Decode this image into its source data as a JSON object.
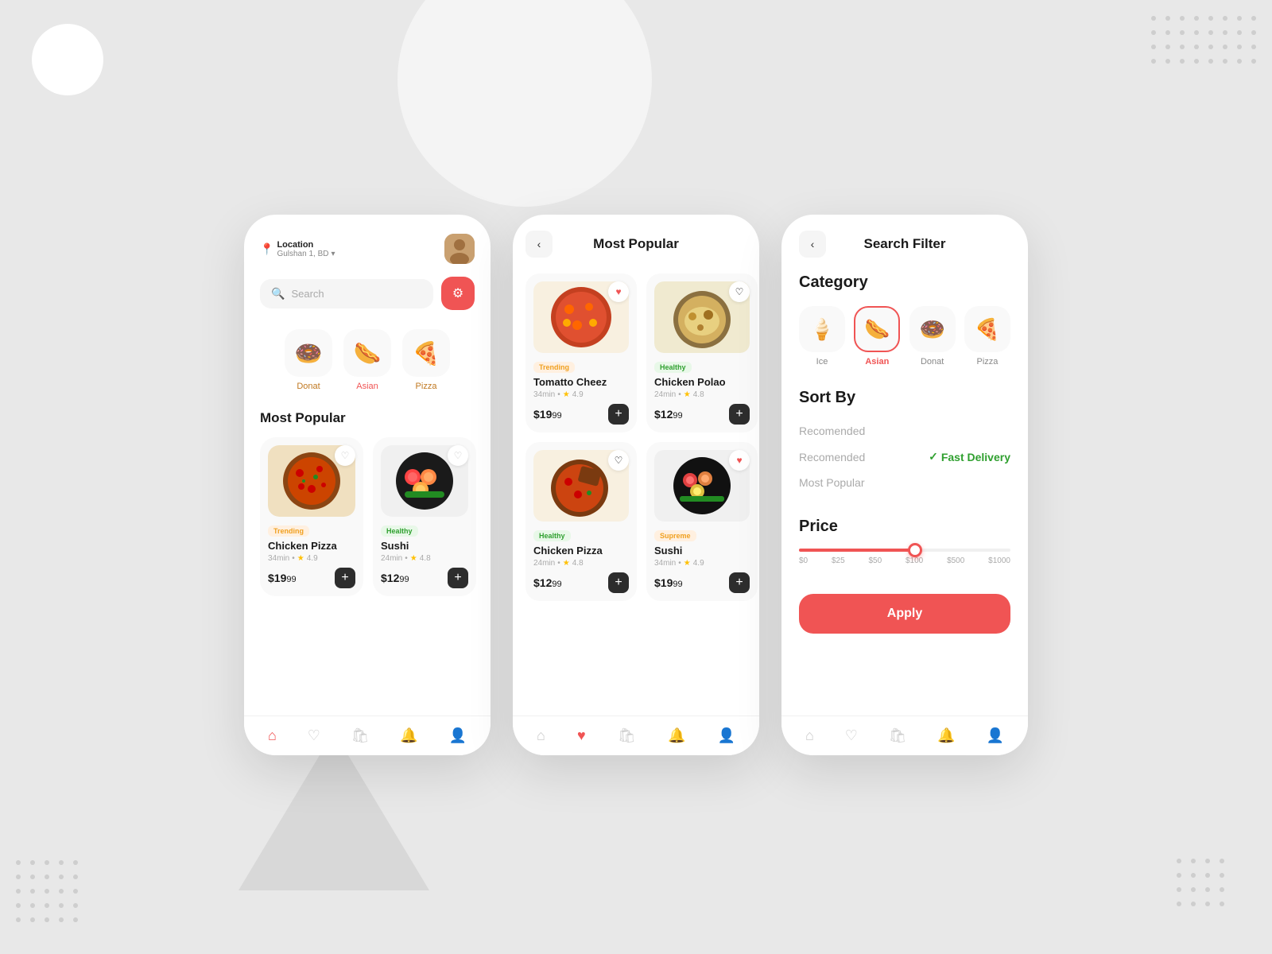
{
  "background": {
    "color": "#e2e2e2"
  },
  "screen1": {
    "location_label": "Location",
    "location_city": "Gulshan 1, BD",
    "search_placeholder": "Search",
    "categories": [
      {
        "id": "donat",
        "label": "Donat",
        "emoji": "🍩",
        "color": "#c07820"
      },
      {
        "id": "asian",
        "label": "Asian",
        "emoji": "🌭",
        "color": "#f05454"
      },
      {
        "id": "pizza",
        "label": "Pizza",
        "emoji": "🍕",
        "color": "#c07820"
      }
    ],
    "section_title": "Most Popular",
    "cards": [
      {
        "name": "Chicken Pizza",
        "badge": "Trending",
        "badge_type": "trending",
        "time": "34min",
        "rating": "4.9",
        "price": "$19",
        "cents": "99"
      },
      {
        "name": "Sushi",
        "badge": "Healthy",
        "badge_type": "healthy",
        "time": "24min",
        "rating": "4.8",
        "price": "$12",
        "cents": "99"
      }
    ],
    "nav_items": [
      "home",
      "heart",
      "bag",
      "bell",
      "person"
    ]
  },
  "screen2": {
    "title": "Most Popular",
    "back_label": "‹",
    "cards": [
      {
        "name": "Tomatto Cheez",
        "badge": "Trending",
        "badge_type": "trending",
        "time": "34min",
        "rating": "4.9",
        "price": "$19",
        "cents": "99",
        "liked": true
      },
      {
        "name": "Chicken Polao",
        "badge": "Healthy",
        "badge_type": "healthy",
        "time": "24min",
        "rating": "4.8",
        "price": "$12",
        "cents": "99",
        "liked": false
      },
      {
        "name": "Chicken Pizza",
        "badge": "Healthy",
        "badge_type": "healthy",
        "time": "24min",
        "rating": "4.8",
        "price": "$12",
        "cents": "99",
        "liked": false
      },
      {
        "name": "Sushi",
        "badge": "Supreme",
        "badge_type": "supreme",
        "time": "34min",
        "rating": "4.9",
        "price": "$19",
        "cents": "99",
        "liked": true
      }
    ],
    "nav_items": [
      "home",
      "heart",
      "bag",
      "bell",
      "person"
    ]
  },
  "screen3": {
    "title": "Search Filter",
    "back_label": "‹",
    "category_section": "Category",
    "categories": [
      {
        "id": "ice",
        "label": "Ice",
        "emoji": "🍦",
        "selected": false
      },
      {
        "id": "asian",
        "label": "Asian",
        "emoji": "🌭",
        "selected": true
      },
      {
        "id": "donat",
        "label": "Donat",
        "emoji": "🍩",
        "selected": false
      },
      {
        "id": "pizza",
        "label": "Pizza",
        "emoji": "🍕",
        "selected": false
      }
    ],
    "sort_section": "Sort By",
    "sort_options": [
      {
        "label": "Recomended",
        "value": "",
        "selected": false
      },
      {
        "label": "Fast Delivery",
        "value": "Fast Delivery",
        "selected": true
      },
      {
        "label": "Most Popular",
        "value": "",
        "selected": false
      }
    ],
    "price_section": "Price",
    "price_labels": [
      "$0",
      "$25",
      "$50",
      "$100",
      "$500",
      "$1000"
    ],
    "price_value": 100,
    "price_fill_percent": 55,
    "apply_label": "Apply",
    "nav_items": [
      "home",
      "heart",
      "bag",
      "bell",
      "person"
    ]
  }
}
